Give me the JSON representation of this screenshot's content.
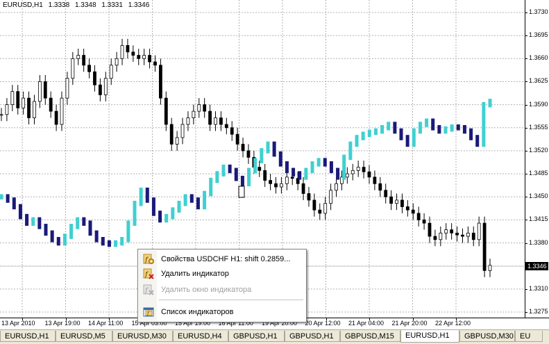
{
  "header": {
    "symbol": "EURUSD,H1",
    "open": "1.3338",
    "high": "1.3348",
    "low": "1.3331",
    "close": "1.3346"
  },
  "price_axis": {
    "labels": [
      "1.3730",
      "1.3695",
      "1.3660",
      "1.3625",
      "1.3590",
      "1.3555",
      "1.3520",
      "1.3485",
      "1.3450",
      "1.3415",
      "1.3380",
      "1.3310",
      "1.3275"
    ],
    "current_price": "1.3346"
  },
  "time_axis": {
    "labels": [
      "13 Apr 2010",
      "13 Apr 19:00",
      "14 Apr 11:00",
      "15 Apr 03:00",
      "15 Apr 19:00",
      "16 Apr 11:00",
      "19 Apr 20:00",
      "20 Apr 12:00",
      "21 Apr 04:00",
      "21 Apr 20:00",
      "22 Apr 12:00"
    ]
  },
  "context_menu": {
    "items": [
      {
        "label": "Свойства USDCHF H1: shift 0.2859...",
        "icon": "indicator-properties-icon",
        "enabled": true
      },
      {
        "label": "Удалить индикатор",
        "icon": "delete-indicator-icon",
        "enabled": true
      },
      {
        "label": "Удалить окно индикатора",
        "icon": "delete-indicator-window-icon",
        "enabled": false
      },
      {
        "label": "Список индикаторов",
        "icon": "indicator-list-icon",
        "enabled": true
      }
    ]
  },
  "tabs": [
    {
      "label": "EURUSD,H1",
      "active": false
    },
    {
      "label": "EURUSD,M5",
      "active": false
    },
    {
      "label": "EURUSD,M30",
      "active": false
    },
    {
      "label": "EURUSD,H4",
      "active": false
    },
    {
      "label": "GBPUSD,H1",
      "active": false
    },
    {
      "label": "GBPUSD,H1",
      "active": false
    },
    {
      "label": "GBPUSD,M15",
      "active": false
    },
    {
      "label": "EURUSD,H1",
      "active": true
    },
    {
      "label": "GBPUSD,M30",
      "active": false
    },
    {
      "label": "EU",
      "active": false
    }
  ],
  "colors": {
    "price_bar_color": "#000000",
    "indicator_up_color": "#40d0d0",
    "indicator_down_color": "#1a1a7a",
    "grid_color": "#b0b0b0"
  },
  "chart_data": {
    "type": "line",
    "series": [
      {
        "values": [
          1.3575,
          1.359,
          1.361,
          1.3585,
          1.36,
          1.357,
          1.3595,
          1.3625,
          1.36,
          1.358,
          1.356,
          1.36,
          1.363,
          1.366,
          1.3665,
          1.365,
          1.364,
          1.362,
          1.3605,
          1.363,
          1.365,
          1.366,
          1.368,
          1.367,
          1.3665,
          1.366,
          1.3665,
          1.3655,
          1.365,
          1.36,
          1.356,
          1.353,
          1.354,
          1.356,
          1.357,
          1.358,
          1.359,
          1.358,
          1.356,
          1.357,
          1.356,
          1.3555,
          1.3545,
          1.353,
          1.352,
          1.351,
          1.3495,
          1.349,
          1.3475,
          1.347,
          1.3465,
          1.347,
          1.348,
          1.3478,
          1.347,
          1.3455,
          1.3445,
          1.343,
          1.3425,
          1.344,
          1.346,
          1.347,
          1.348,
          1.3485,
          1.349,
          1.3495,
          1.3488,
          1.348,
          1.347,
          1.346,
          1.345,
          1.344,
          1.3445,
          1.3435,
          1.343,
          1.3425,
          1.3415,
          1.341,
          1.339,
          1.3385,
          1.3395,
          1.34,
          1.3395,
          1.3392,
          1.339,
          1.3395,
          1.3385,
          1.341,
          1.3338,
          1.3346
        ],
        "x_start": "13 Apr 2010",
        "x_end": "22 Apr 12:00"
      },
      {
        "values": [
          1.345,
          1.3445,
          1.3435,
          1.342,
          1.341,
          1.3415,
          1.3405,
          1.3395,
          1.3385,
          1.338,
          1.339,
          1.3405,
          1.3415,
          1.341,
          1.3395,
          1.3385,
          1.338,
          1.3378,
          1.338,
          1.3385,
          1.341,
          1.344,
          1.346,
          1.3445,
          1.3425,
          1.3415,
          1.342,
          1.343,
          1.344,
          1.345,
          1.3445,
          1.3435,
          1.3455,
          1.3475,
          1.3485,
          1.3495,
          1.349,
          1.3478,
          1.347,
          1.349,
          1.3505,
          1.352,
          1.353,
          1.3515,
          1.35,
          1.349,
          1.3485,
          1.348,
          1.349,
          1.35,
          1.3505,
          1.35,
          1.349,
          1.348,
          1.351,
          1.353,
          1.354,
          1.3545,
          1.3548,
          1.355,
          1.3555,
          1.356,
          1.355,
          1.354,
          1.353,
          1.355,
          1.356,
          1.3565,
          1.3555,
          1.355,
          1.3553,
          1.3556,
          1.3555,
          1.355,
          1.354,
          1.353,
          1.359,
          1.3595
        ]
      }
    ],
    "ylim": [
      1.3275,
      1.373
    ],
    "grid": true
  }
}
